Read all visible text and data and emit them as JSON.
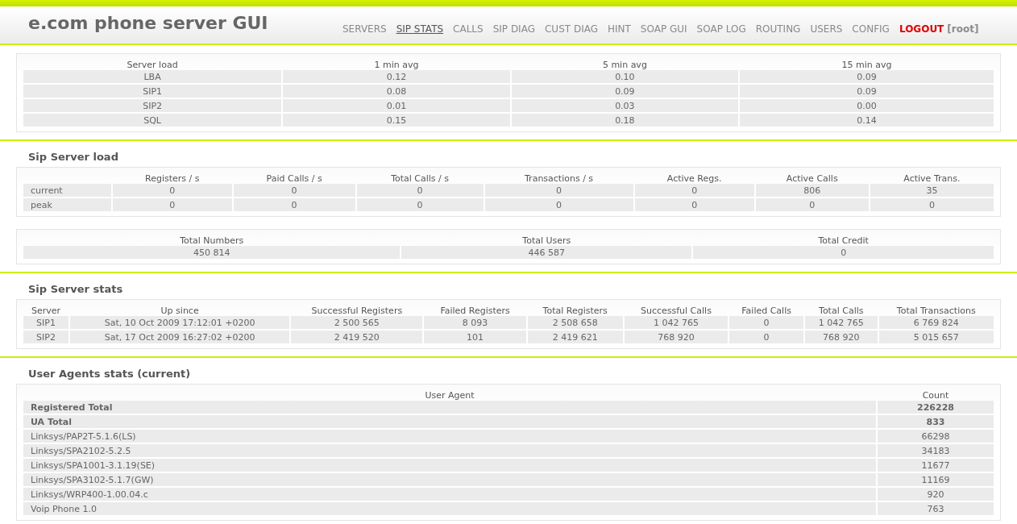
{
  "header": {
    "title": "e.com phone server GUI"
  },
  "nav": [
    {
      "label": "SERVERS",
      "kind": "link",
      "selected": false
    },
    {
      "label": "SIP STATS",
      "kind": "link",
      "selected": true
    },
    {
      "label": "CALLS",
      "kind": "link",
      "selected": false
    },
    {
      "label": "SIP DIAG",
      "kind": "link",
      "selected": false
    },
    {
      "label": "CUST DIAG",
      "kind": "link",
      "selected": false
    },
    {
      "label": "HINT",
      "kind": "link",
      "selected": false
    },
    {
      "label": "SOAP GUI",
      "kind": "link",
      "selected": false
    },
    {
      "label": "SOAP LOG",
      "kind": "link",
      "selected": false
    },
    {
      "label": "ROUTING",
      "kind": "link",
      "selected": false
    },
    {
      "label": "USERS",
      "kind": "link",
      "selected": false
    },
    {
      "label": "CONFIG",
      "kind": "link",
      "selected": false
    },
    {
      "label": "LOGOUT",
      "kind": "logout",
      "selected": false
    }
  ],
  "user": "[root]",
  "sections": [
    {
      "tables": [
        {
          "kind": "plain",
          "columns": [
            "Server load",
            "1 min avg",
            "5 min avg",
            "15 min avg"
          ],
          "rows": [
            [
              "LBA",
              "0.12",
              "0.10",
              "0.09"
            ],
            [
              "SIP1",
              "0.08",
              "0.09",
              "0.09"
            ],
            [
              "SIP2",
              "0.01",
              "0.03",
              "0.00"
            ],
            [
              "SQL",
              "0.15",
              "0.18",
              "0.14"
            ]
          ]
        }
      ]
    },
    {
      "title": "Sip Server load",
      "tables": [
        {
          "kind": "labelled",
          "columns": [
            "",
            "Registers / s",
            "Paid Calls / s",
            "Total Calls / s",
            "Transactions / s",
            "Active Regs.",
            "Active Calls",
            "Active Trans."
          ],
          "rows": [
            [
              "current",
              "0",
              "0",
              "0",
              "0",
              "0",
              "806",
              "35"
            ],
            [
              "peak",
              "0",
              "0",
              "0",
              "0",
              "0",
              "0",
              "0"
            ]
          ]
        },
        {
          "kind": "plain",
          "columns": [
            "Total Numbers",
            "Total Users",
            "Total Credit"
          ],
          "rows": [
            [
              "450 814",
              "446 587",
              "0"
            ]
          ]
        }
      ]
    },
    {
      "title": "Sip Server stats",
      "tables": [
        {
          "kind": "plain",
          "columns": [
            "Server",
            "Up since",
            "Successful Registers",
            "Failed Registers",
            "Total Registers",
            "Successful Calls",
            "Failed Calls",
            "Total Calls",
            "Total Transactions"
          ],
          "rows": [
            [
              "SIP1",
              "Sat, 10 Oct 2009 17:12:01 +0200",
              "2 500 565",
              "8 093",
              "2 508 658",
              "1 042 765",
              "0",
              "1 042 765",
              "6 769 824"
            ],
            [
              "SIP2",
              "Sat, 17 Oct 2009 16:27:02 +0200",
              "2 419 520",
              "101",
              "2 419 621",
              "768 920",
              "0",
              "768 920",
              "5 015 657"
            ]
          ]
        }
      ]
    },
    {
      "title": "User Agents stats (current)",
      "agents": {
        "columns": [
          "User Agent",
          "Count"
        ],
        "rows": [
          {
            "kind": "total",
            "agent": "Registered Total",
            "count": "226228"
          },
          {
            "kind": "total",
            "agent": "UA Total",
            "count": "833"
          },
          {
            "kind": "agent",
            "agent": "Linksys/PAP2T-5.1.6(LS)",
            "count": "66298"
          },
          {
            "kind": "agent",
            "agent": "Linksys/SPA2102-5.2.5",
            "count": "34183"
          },
          {
            "kind": "agent",
            "agent": "Linksys/SPA1001-3.1.19(SE)",
            "count": "11677"
          },
          {
            "kind": "agent",
            "agent": "Linksys/SPA3102-5.1.7(GW)",
            "count": "11169"
          },
          {
            "kind": "agent",
            "agent": "Linksys/WRP400-1.00.04.c",
            "count": "920"
          },
          {
            "kind": "agent",
            "agent": "Voip Phone 1.0",
            "count": "763"
          }
        ]
      }
    }
  ]
}
